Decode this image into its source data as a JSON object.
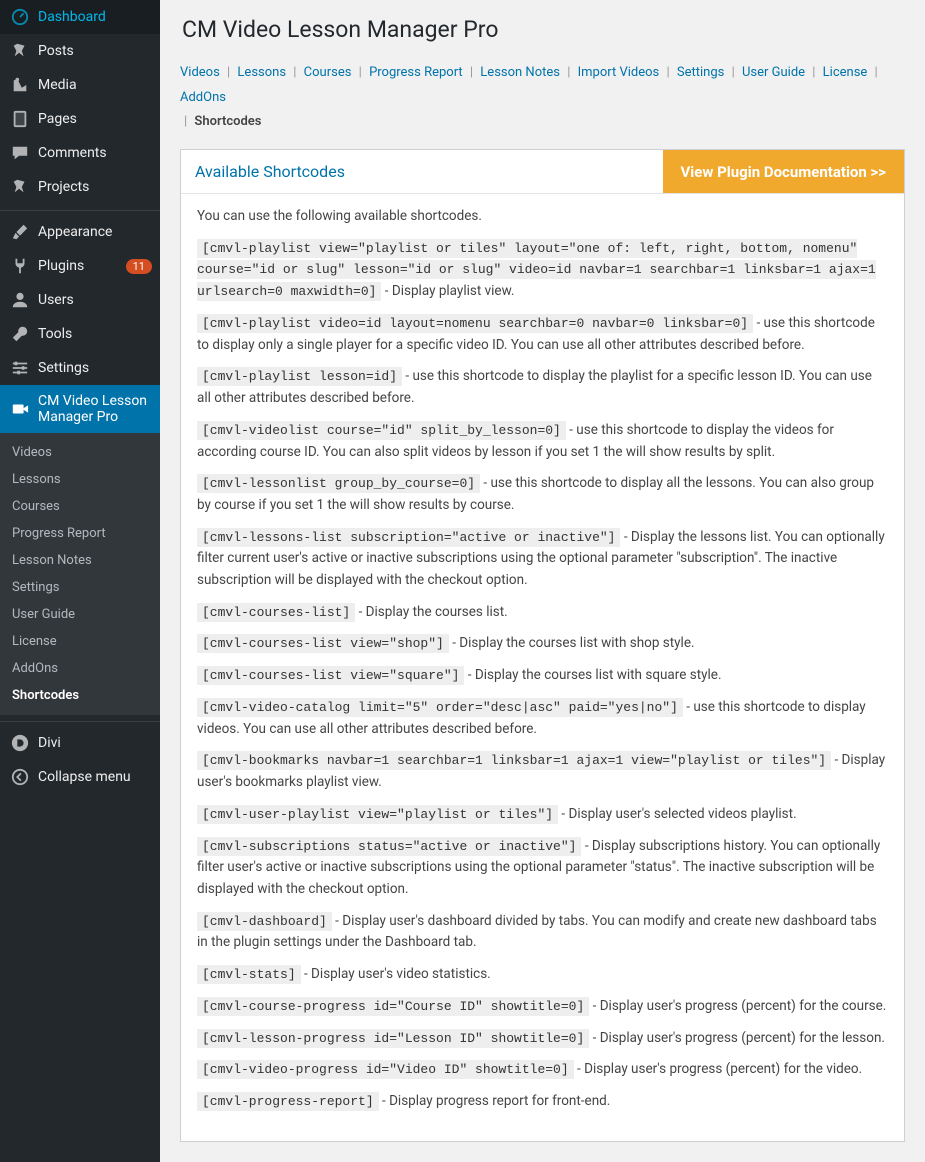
{
  "sidebar": {
    "items": [
      {
        "icon": "dashboard",
        "label": "Dashboard"
      },
      {
        "icon": "pin",
        "label": "Posts"
      },
      {
        "icon": "media",
        "label": "Media"
      },
      {
        "icon": "page",
        "label": "Pages"
      },
      {
        "icon": "comment",
        "label": "Comments"
      },
      {
        "icon": "pin",
        "label": "Projects"
      },
      {
        "icon": "brush",
        "label": "Appearance",
        "sep": true
      },
      {
        "icon": "plug",
        "label": "Plugins",
        "badge": "11"
      },
      {
        "icon": "user",
        "label": "Users"
      },
      {
        "icon": "wrench",
        "label": "Tools"
      },
      {
        "icon": "sliders",
        "label": "Settings"
      },
      {
        "icon": "video",
        "label": "CM Video Lesson Manager Pro",
        "active": true
      },
      {
        "icon": "divi",
        "label": "Divi",
        "sep": true
      },
      {
        "icon": "collapse",
        "label": "Collapse menu"
      }
    ],
    "submenu": [
      {
        "label": "Videos"
      },
      {
        "label": "Lessons"
      },
      {
        "label": "Courses"
      },
      {
        "label": "Progress Report"
      },
      {
        "label": "Lesson Notes"
      },
      {
        "label": "Settings"
      },
      {
        "label": "User Guide"
      },
      {
        "label": "License"
      },
      {
        "label": "AddOns"
      },
      {
        "label": "Shortcodes",
        "current": true
      }
    ]
  },
  "page": {
    "title": "CM Video Lesson Manager Pro"
  },
  "tabs": [
    {
      "label": "Videos"
    },
    {
      "label": "Lessons"
    },
    {
      "label": "Courses"
    },
    {
      "label": "Progress Report"
    },
    {
      "label": "Lesson Notes"
    },
    {
      "label": "Import Videos"
    },
    {
      "label": "Settings"
    },
    {
      "label": "User Guide"
    },
    {
      "label": "License"
    },
    {
      "label": "AddOns"
    },
    {
      "label": "Shortcodes",
      "current": true
    }
  ],
  "panel": {
    "title": "Available Shortcodes",
    "doc_button": "View Plugin Documentation >>",
    "intro": "You can use the following available shortcodes."
  },
  "shortcodes": [
    {
      "code": "[cmvl-playlist view=\"playlist or tiles\" layout=\"one of: left, right, bottom, nomenu\" course=\"id or slug\" lesson=\"id or slug\" video=id navbar=1 searchbar=1 linksbar=1 ajax=1 urlsearch=0 maxwidth=0]",
      "desc": " - Display playlist view."
    },
    {
      "code": "[cmvl-playlist video=id layout=nomenu searchbar=0 navbar=0 linksbar=0]",
      "desc": " - use this shortcode to display only a single player for a specific video ID. You can use all other attributes described before."
    },
    {
      "code": "[cmvl-playlist lesson=id]",
      "desc": " - use this shortcode to display the playlist for a specific lesson ID. You can use all other attributes described before."
    },
    {
      "code": "[cmvl-videolist course=\"id\" split_by_lesson=0]",
      "desc": " - use this shortcode to display the videos for according course ID. You can also split videos by lesson if you set 1 the will show results by split."
    },
    {
      "code": "[cmvl-lessonlist group_by_course=0]",
      "desc": " - use this shortcode to display all the lessons. You can also group by course if you set 1 the will show results by course."
    },
    {
      "code": "[cmvl-lessons-list subscription=\"active or inactive\"]",
      "desc": " - Display the lessons list. You can optionally filter current user's active or inactive subscriptions using the optional parameter \"subscription\". The inactive subscription will be displayed with the checkout option."
    },
    {
      "code": "[cmvl-courses-list]",
      "desc": " - Display the courses list."
    },
    {
      "code": "[cmvl-courses-list view=\"shop\"]",
      "desc": " - Display the courses list with shop style."
    },
    {
      "code": "[cmvl-courses-list view=\"square\"]",
      "desc": " - Display the courses list with square style."
    },
    {
      "code": "[cmvl-video-catalog limit=\"5\" order=\"desc|asc\" paid=\"yes|no\"]",
      "desc": " - use this shortcode to display videos. You can use all other attributes described before."
    },
    {
      "code": "[cmvl-bookmarks navbar=1 searchbar=1 linksbar=1 ajax=1 view=\"playlist or tiles\"]",
      "desc": " - Display user's bookmarks playlist view."
    },
    {
      "code": "[cmvl-user-playlist view=\"playlist or tiles\"]",
      "desc": " - Display user's selected videos playlist."
    },
    {
      "code": "[cmvl-subscriptions status=\"active or inactive\"]",
      "desc": " - Display subscriptions history. You can optionally filter user's active or inactive subscriptions using the optional parameter \"status\". The inactive subscription will be displayed with the checkout option."
    },
    {
      "code": "[cmvl-dashboard]",
      "desc": " - Display user's dashboard divided by tabs. You can modify and create new dashboard tabs in the plugin settings under the Dashboard tab."
    },
    {
      "code": "[cmvl-stats]",
      "desc": " - Display user's video statistics."
    },
    {
      "code": "[cmvl-course-progress id=\"Course ID\" showtitle=0]",
      "desc": " - Display user's progress (percent) for the course."
    },
    {
      "code": "[cmvl-lesson-progress id=\"Lesson ID\" showtitle=0]",
      "desc": " - Display user's progress (percent) for the lesson."
    },
    {
      "code": "[cmvl-video-progress id=\"Video ID\" showtitle=0]",
      "desc": " - Display user's progress (percent) for the video."
    },
    {
      "code": "[cmvl-progress-report]",
      "desc": " - Display progress report for front-end."
    }
  ]
}
